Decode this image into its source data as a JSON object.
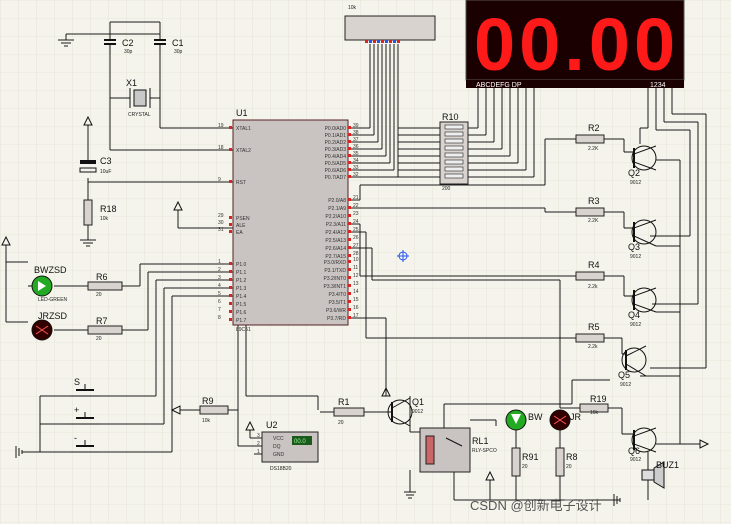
{
  "components": {
    "mcu": {
      "ref": "U1",
      "part": "89C51",
      "left_pins": [
        {
          "num": "19",
          "name": "XTAL1"
        },
        {
          "num": "18",
          "name": "XTAL2"
        },
        {
          "num": "9",
          "name": "RST"
        },
        {
          "num": "29",
          "name": "PSEN"
        },
        {
          "num": "30",
          "name": "ALE"
        },
        {
          "num": "31",
          "name": "EA"
        },
        {
          "num": "1",
          "name": "P1.0"
        },
        {
          "num": "2",
          "name": "P1.1"
        },
        {
          "num": "3",
          "name": "P1.2"
        },
        {
          "num": "4",
          "name": "P1.3"
        },
        {
          "num": "5",
          "name": "P1.4"
        },
        {
          "num": "6",
          "name": "P1.5"
        },
        {
          "num": "7",
          "name": "P1.6"
        },
        {
          "num": "8",
          "name": "P1.7"
        }
      ],
      "right_pins": [
        {
          "num": "39",
          "name": "P0.0/AD0"
        },
        {
          "num": "38",
          "name": "P0.1/AD1"
        },
        {
          "num": "37",
          "name": "P0.2/AD2"
        },
        {
          "num": "36",
          "name": "P0.3/AD3"
        },
        {
          "num": "35",
          "name": "P0.4/AD4"
        },
        {
          "num": "34",
          "name": "P0.5/AD5"
        },
        {
          "num": "33",
          "name": "P0.6/AD6"
        },
        {
          "num": "32",
          "name": "P0.7/AD7"
        },
        {
          "num": "21",
          "name": "P2.0/A8"
        },
        {
          "num": "22",
          "name": "P2.1/A9"
        },
        {
          "num": "23",
          "name": "P2.2/A10"
        },
        {
          "num": "24",
          "name": "P2.3/A11"
        },
        {
          "num": "25",
          "name": "P2.4/A12"
        },
        {
          "num": "26",
          "name": "P2.5/A13"
        },
        {
          "num": "27",
          "name": "P2.6/A14"
        },
        {
          "num": "28",
          "name": "P2.7/A15"
        },
        {
          "num": "10",
          "name": "P3.0/RXD"
        },
        {
          "num": "11",
          "name": "P3.1/TXD"
        },
        {
          "num": "12",
          "name": "P3.2/INT0"
        },
        {
          "num": "13",
          "name": "P3.3/INT1"
        },
        {
          "num": "14",
          "name": "P3.4/T0"
        },
        {
          "num": "15",
          "name": "P3.5/T1"
        },
        {
          "num": "16",
          "name": "P3.6/WR"
        },
        {
          "num": "17",
          "name": "P3.7/RD"
        }
      ]
    },
    "display": {
      "digits": "00.00",
      "segments_label": "ABCDEFG DP",
      "digit_label": "1234"
    },
    "respack_top": {
      "value": "10k"
    },
    "r10": {
      "ref": "R10",
      "value": "200"
    },
    "c1": {
      "ref": "C1",
      "value": "30p"
    },
    "c2": {
      "ref": "C2",
      "value": "30p"
    },
    "c3": {
      "ref": "C3",
      "value": "10uF"
    },
    "x1": {
      "ref": "X1",
      "value": "CRYSTAL"
    },
    "r18": {
      "ref": "R18",
      "value": "10k"
    },
    "led1": {
      "ref": "BWZSD",
      "value": "LED-GREEN"
    },
    "led2": {
      "ref": "JRZSD"
    },
    "r6": {
      "ref": "R6",
      "value": "20"
    },
    "r7": {
      "ref": "R7",
      "value": "20"
    },
    "sw1": {
      "ref": "S"
    },
    "sw2": {
      "ref": "+"
    },
    "sw3": {
      "ref": "-"
    },
    "r9": {
      "ref": "R9",
      "value": "10k"
    },
    "u2": {
      "ref": "U2",
      "part": "DS18B20",
      "pins": [
        "VCC",
        "DQ",
        "GND"
      ],
      "pin_nums": [
        "3",
        "2",
        "1"
      ],
      "reading": "00.0"
    },
    "r1": {
      "ref": "R1",
      "value": "20"
    },
    "q1": {
      "ref": "Q1",
      "value": "9012"
    },
    "rl1": {
      "ref": "RL1",
      "value": "RLY-SPCO"
    },
    "bw": {
      "ref": "BW"
    },
    "jr": {
      "ref": "JR"
    },
    "r91": {
      "ref": "R91",
      "value": "20"
    },
    "r8": {
      "ref": "R8",
      "value": "20"
    },
    "r2": {
      "ref": "R2",
      "value": "2.2K"
    },
    "r3": {
      "ref": "R3",
      "value": "2.2K"
    },
    "r4": {
      "ref": "R4",
      "value": "2.2k"
    },
    "r5": {
      "ref": "R5",
      "value": "2.2k"
    },
    "r19": {
      "ref": "R19",
      "value": "10k"
    },
    "q2": {
      "ref": "Q2",
      "value": "9012"
    },
    "q3": {
      "ref": "Q3",
      "value": "9012"
    },
    "q4": {
      "ref": "Q4",
      "value": "9012"
    },
    "q5": {
      "ref": "Q5",
      "value": "9012"
    },
    "q6": {
      "ref": "Q6",
      "value": "9012"
    },
    "buz": {
      "ref": "BUZ1"
    }
  },
  "watermark": "CSDN @创新电子设计",
  "colors": {
    "background": "#f4f4ec",
    "segment_on": "#ff1a1a",
    "segment_bg": "#1a0000",
    "led_green": "#22aa22",
    "led_red": "#cc1010",
    "chip_fill": "#c9c3c1",
    "pin_red": "#dd2222",
    "pin_blue": "#2255ee"
  }
}
